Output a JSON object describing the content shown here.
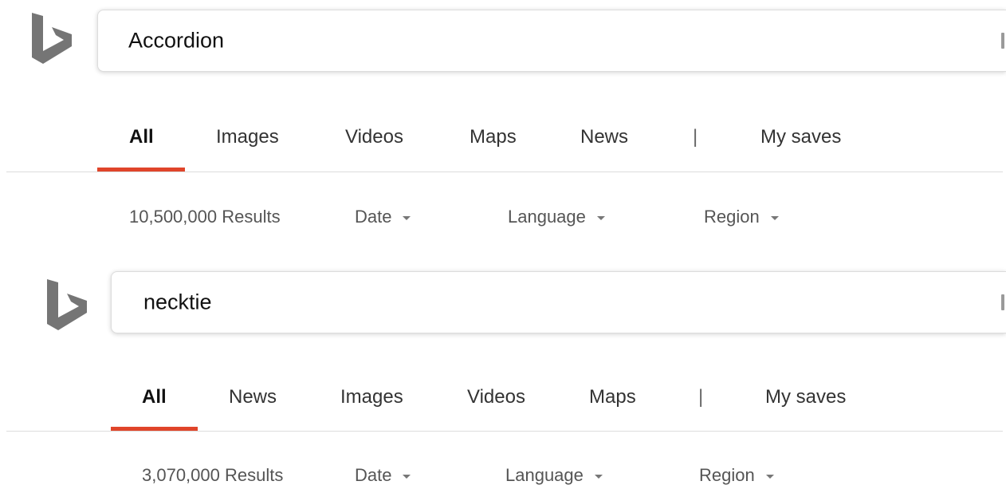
{
  "accent_color": "#e0452a",
  "logo_icon": "bing-logo-icon",
  "searches": [
    {
      "query": "Accordion",
      "tabs": [
        "All",
        "Images",
        "Videos",
        "Maps",
        "News"
      ],
      "separator": "|",
      "saves_label": "My saves",
      "results_count": "10,500,000 Results",
      "filters": [
        "Date",
        "Language",
        "Region"
      ]
    },
    {
      "query": "necktie",
      "tabs": [
        "All",
        "News",
        "Images",
        "Videos",
        "Maps"
      ],
      "separator": "|",
      "saves_label": "My saves",
      "results_count": "3,070,000 Results",
      "filters": [
        "Date",
        "Language",
        "Region"
      ]
    }
  ]
}
